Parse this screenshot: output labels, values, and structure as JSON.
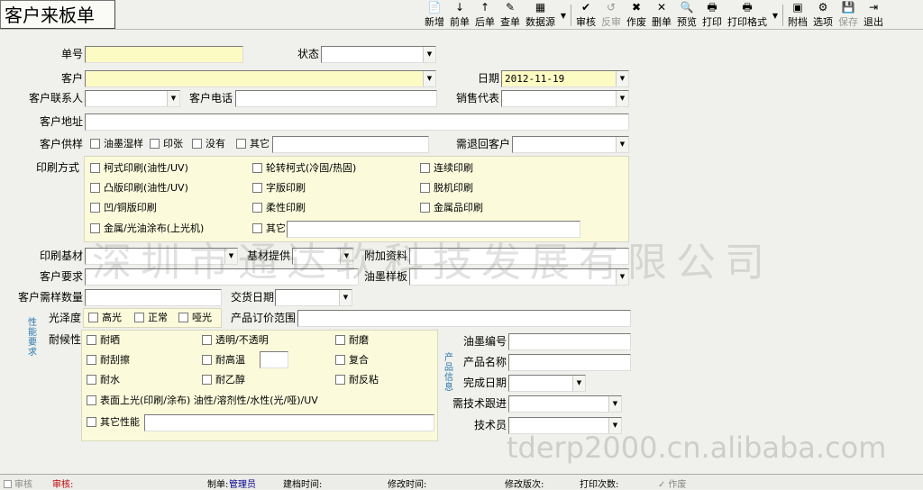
{
  "window": {
    "title": "客户来板单"
  },
  "toolbar": [
    {
      "name": "add-button",
      "label": "新增",
      "icon": "📄",
      "disabled": false
    },
    {
      "name": "prev-button",
      "label": "前单",
      "icon": "↓",
      "disabled": false
    },
    {
      "name": "next-button",
      "label": "后单",
      "icon": "↑",
      "disabled": false
    },
    {
      "name": "lookup-button",
      "label": "查单",
      "icon": "✎",
      "disabled": false
    },
    {
      "name": "datasource-button",
      "label": "数据源",
      "icon": "▦",
      "disabled": false
    },
    {
      "name": "approve-button",
      "label": "审核",
      "icon": "✔",
      "disabled": false
    },
    {
      "name": "unapprove-button",
      "label": "反审",
      "icon": "↺",
      "disabled": true
    },
    {
      "name": "void-button",
      "label": "作废",
      "icon": "✖",
      "disabled": false
    },
    {
      "name": "delete-button",
      "label": "删单",
      "icon": "✕",
      "disabled": false
    },
    {
      "name": "preview-button",
      "label": "预览",
      "icon": "🔍",
      "disabled": false
    },
    {
      "name": "print-button",
      "label": "打印",
      "icon": "🖶",
      "disabled": false
    },
    {
      "name": "print-format-button",
      "label": "打印格式",
      "icon": "🖶",
      "disabled": false
    },
    {
      "name": "attachment-button",
      "label": "附档",
      "icon": "▣",
      "disabled": false
    },
    {
      "name": "options-button",
      "label": "选项",
      "icon": "⚙",
      "disabled": false
    },
    {
      "name": "save-button",
      "label": "保存",
      "icon": "💾",
      "disabled": true
    },
    {
      "name": "exit-button",
      "label": "退出",
      "icon": "⇥",
      "disabled": false
    }
  ],
  "form": {
    "order_no": {
      "label": "单号",
      "value": ""
    },
    "status": {
      "label": "状态",
      "value": ""
    },
    "customer": {
      "label": "客户",
      "value": ""
    },
    "date": {
      "label": "日期",
      "value": "2012-11-19"
    },
    "contact": {
      "label": "客户联系人",
      "value": ""
    },
    "phone": {
      "label": "客户电话",
      "value": ""
    },
    "sales_rep": {
      "label": "销售代表",
      "value": ""
    },
    "address": {
      "label": "客户地址",
      "value": ""
    },
    "sample_supply": {
      "label": "客户供样",
      "options": [
        "油墨湿样",
        "印张",
        "没有",
        "其它"
      ]
    },
    "return_customer": {
      "label": "需退回客户",
      "value": ""
    },
    "print_method": {
      "label": "印刷方式",
      "options": [
        "柯式印刷(油性/UV)",
        "轮转柯式(冷固/热固)",
        "连续印刷",
        "凸版印刷(油性/UV)",
        "字版印刷",
        "脱机印刷",
        "凹/铜版印刷",
        "柔性印刷",
        "金属品印刷",
        "金属/光油涂布(上光机)",
        "其它"
      ]
    },
    "substrate": {
      "label": "印刷基材",
      "value": ""
    },
    "substrate_supply": {
      "label": "基材提供",
      "value": ""
    },
    "extra_info": {
      "label": "附加资料",
      "value": ""
    },
    "requirements": {
      "label": "客户要求",
      "value": ""
    },
    "ink_sample": {
      "label": "油墨样板",
      "value": ""
    },
    "sample_qty": {
      "label": "客户需样数量",
      "value": ""
    },
    "delivery_date": {
      "label": "交货日期",
      "value": ""
    },
    "gloss": {
      "label": "光泽度",
      "options": [
        "高光",
        "正常",
        "哑光"
      ]
    },
    "price_range": {
      "label": "产品订价范围",
      "value": ""
    },
    "perf_section": "性能要求",
    "weather": {
      "label": "耐候性",
      "options": [
        "耐晒",
        "透明/不透明",
        "耐磨",
        "耐刮擦",
        "耐高温",
        "复合",
        "耐水",
        "耐乙醇",
        "耐反粘",
        "表面上光(印刷/涂布) 油性/溶剂性/水性(光/哑)/UV",
        "其它性能"
      ]
    },
    "product_section": "产品信息",
    "ink_no": {
      "label": "油墨编号",
      "value": ""
    },
    "product_name": {
      "label": "产品名称",
      "value": ""
    },
    "finish_date": {
      "label": "完成日期",
      "value": ""
    },
    "tech_follow": {
      "label": "需技术跟进",
      "value": ""
    },
    "technician": {
      "label": "技术员",
      "value": ""
    }
  },
  "watermark": "深圳市通达软科技发展有限公司",
  "watermark2": "tderp2000.cn.alibaba.com",
  "statusbar": {
    "approve_chk": "审核",
    "approved_by": "审核:",
    "creator_label": "制单:",
    "creator_value": "管理员",
    "created_label": "建档时间:",
    "modified_label": "修改时间:",
    "revision_label": "修改版次:",
    "print_count_label": "打印次数:",
    "void_chk": "作废"
  }
}
